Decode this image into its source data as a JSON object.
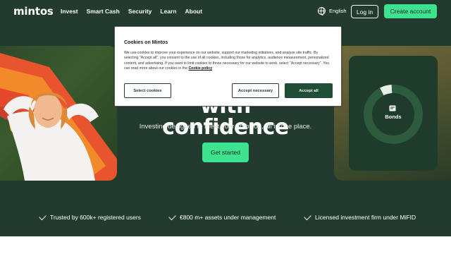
{
  "nav": {
    "logo": "mintos",
    "links": [
      "Invest",
      "Smart Cash",
      "Security",
      "Learn",
      "About"
    ],
    "language": "English",
    "login_label": "Log in",
    "create_label": "Create account",
    "globe_icon": "globe-icon"
  },
  "hero": {
    "title": "with confidence",
    "subtitle": "Investing designed to meet your ambition, all in one place.",
    "cta_label": "Get started"
  },
  "bonds_card": {
    "label": "Bonds",
    "icon": "document-icon",
    "ring_progress": 0.08
  },
  "trust": [
    {
      "icon": "check-icon",
      "text": "Trusted by 600k+ registered users"
    },
    {
      "icon": "check-icon",
      "text": "€800 m+ assets under management"
    },
    {
      "icon": "check-icon",
      "text": "Licensed investment firm under MiFID"
    }
  ],
  "cookie": {
    "title": "Cookies on Mintos",
    "body": "We use cookies to improve your experience on our website, support our marketing initiatives, and analyze site traffic. By selecting \"Accept all\", you consent to the use of all cookies, including those for analytics, audience measurement, personalized content, and advertising. If you want to limit cookies to those necessary for our website to work, select \"Accept necessary\". You can read more about our cookies in the",
    "policy_link": "Cookie policy",
    "select_label": "Select cookies",
    "necessary_label": "Accept necessary",
    "all_label": "Accept all"
  },
  "colors": {
    "background": "#223b2e",
    "accent": "#3de38f",
    "card": "#1e3b2b",
    "dialog_primary": "#1f4d36"
  }
}
